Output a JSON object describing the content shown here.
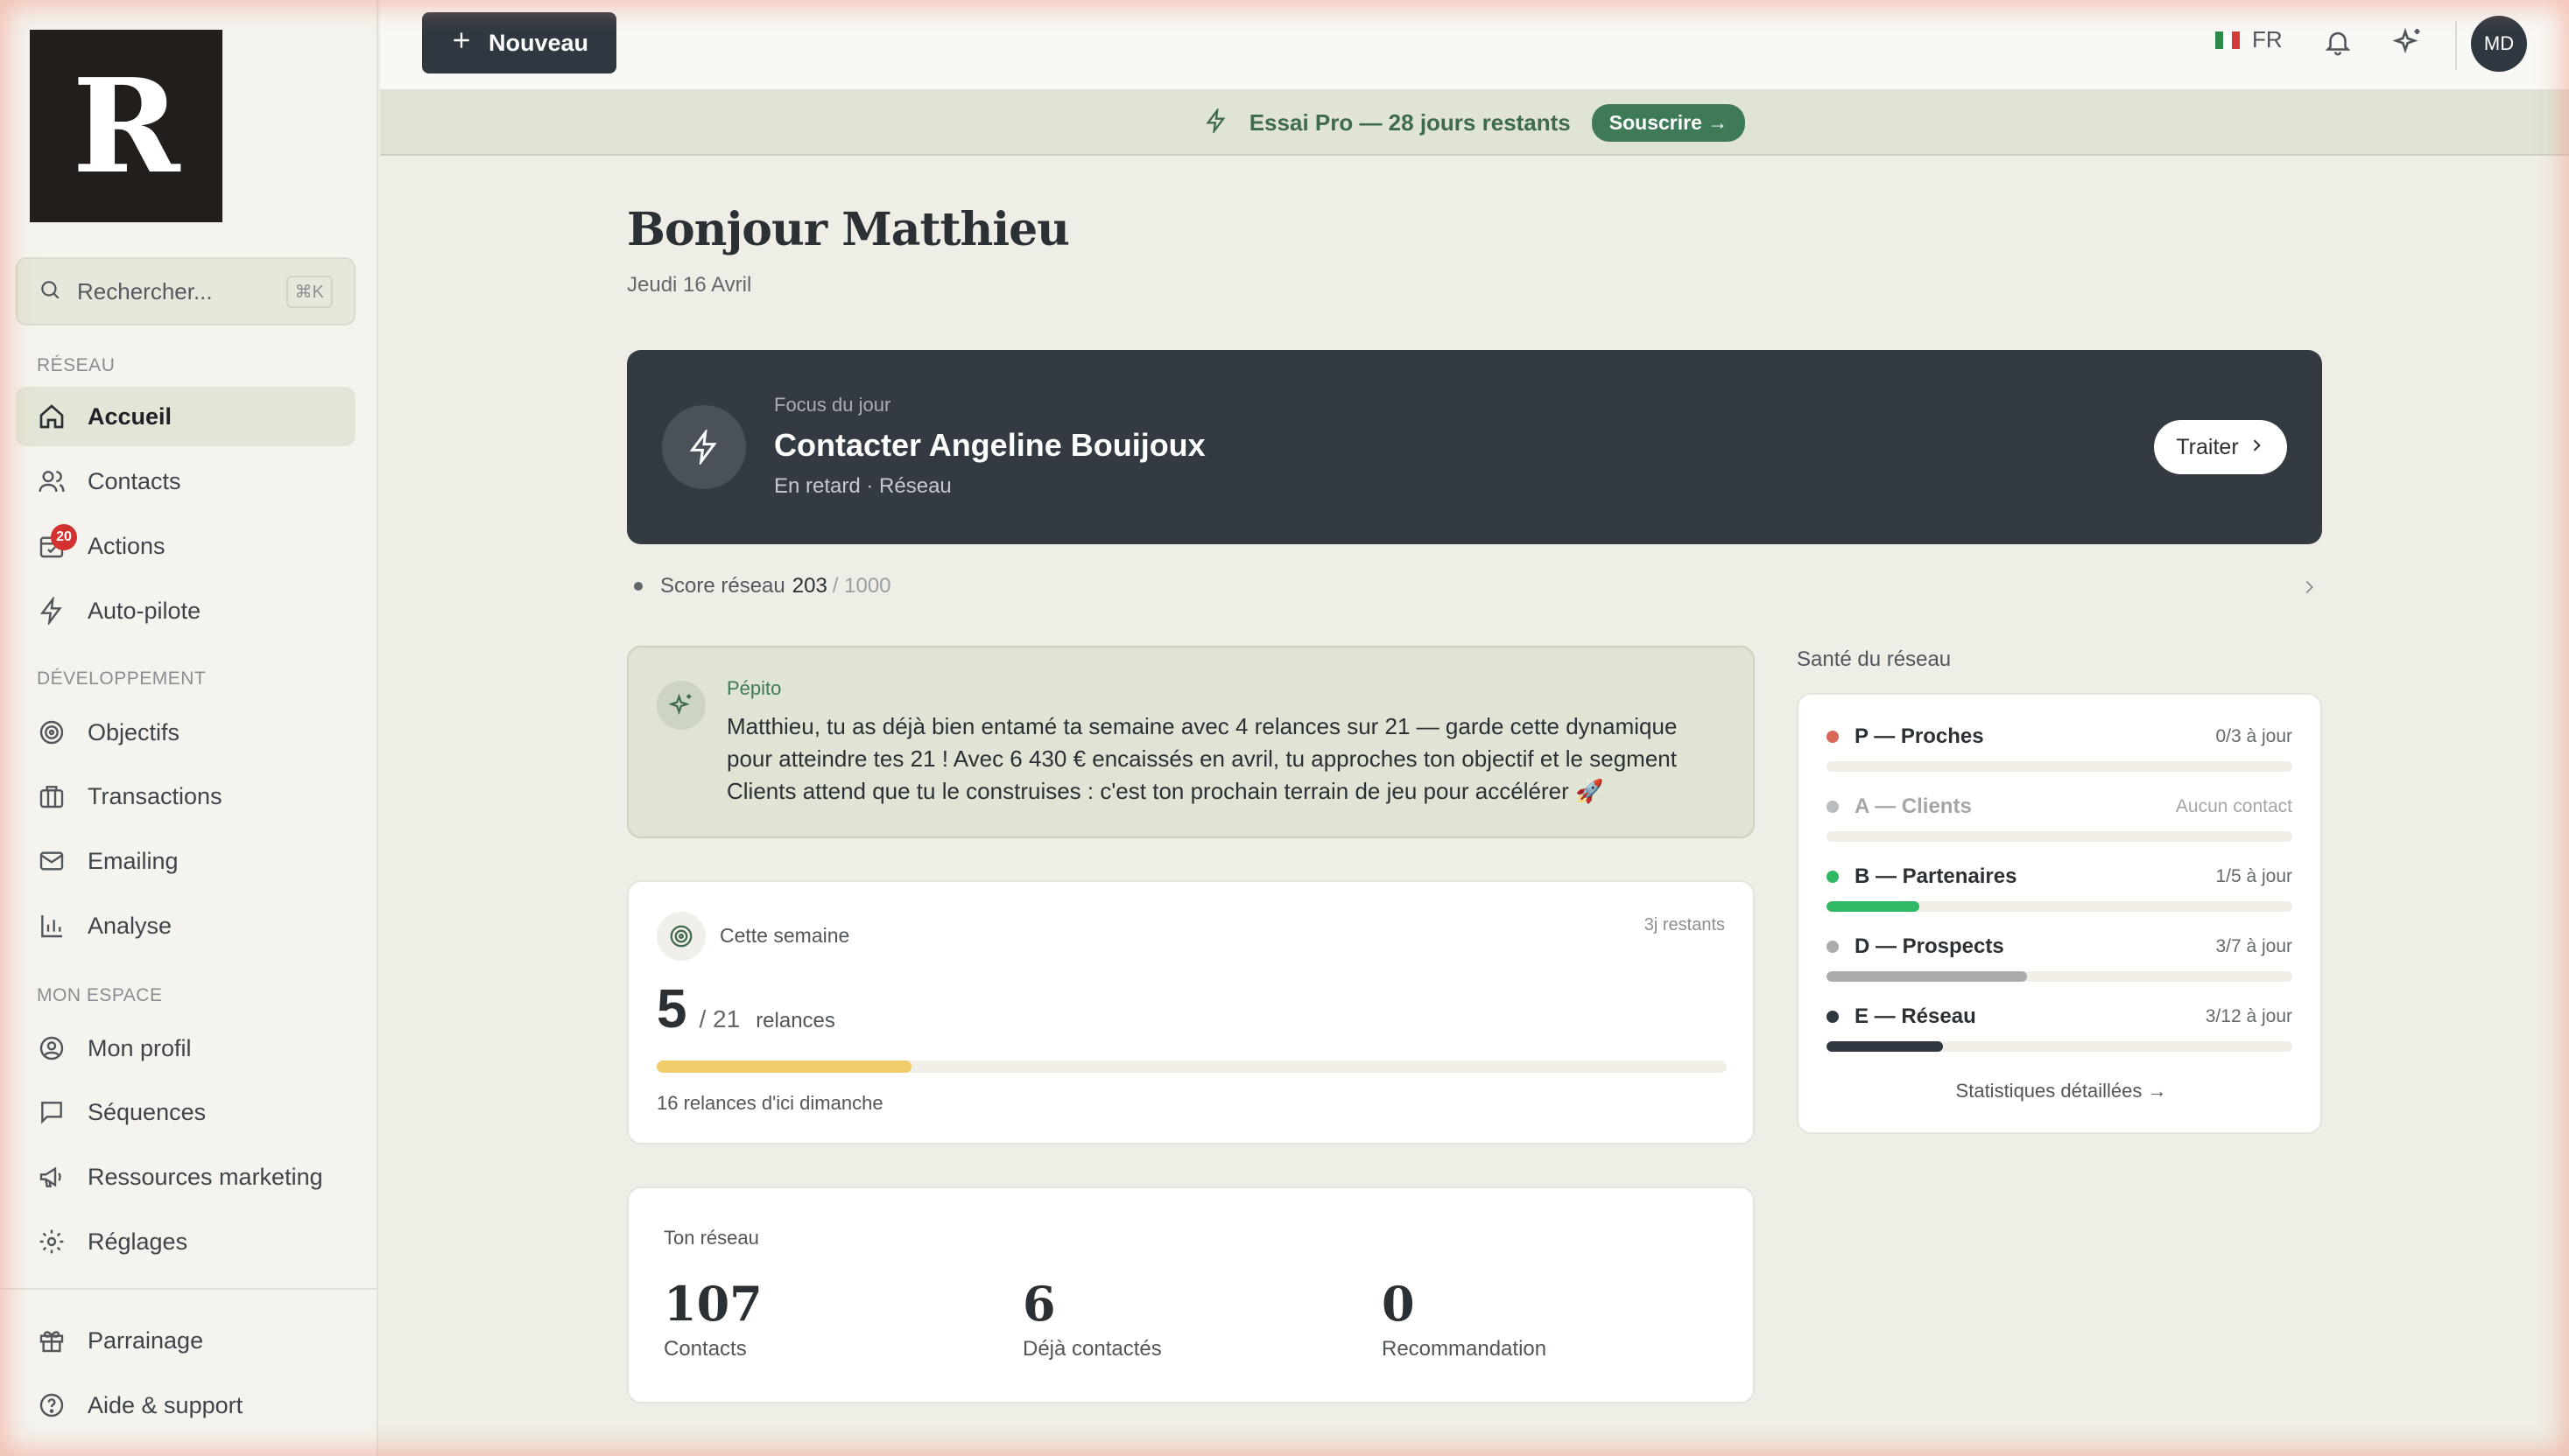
{
  "logo_letter": "R",
  "search": {
    "placeholder": "Rechercher...",
    "shortcut": "⌘K"
  },
  "sidebar": {
    "sections": [
      {
        "label": "RÉSEAU"
      },
      {
        "label": "DÉVELOPPEMENT"
      },
      {
        "label": "MON ESPACE"
      }
    ],
    "items": [
      {
        "label": "Accueil",
        "icon": "home-icon",
        "active": true
      },
      {
        "label": "Contacts",
        "icon": "users-icon"
      },
      {
        "label": "Actions",
        "icon": "calendar-check-icon",
        "badge": "20"
      },
      {
        "label": "Auto-pilote",
        "icon": "bolt-icon"
      },
      {
        "label": "Objectifs",
        "icon": "target-icon"
      },
      {
        "label": "Transactions",
        "icon": "briefcase-icon"
      },
      {
        "label": "Emailing",
        "icon": "mail-icon"
      },
      {
        "label": "Analyse",
        "icon": "bar-chart-icon"
      },
      {
        "label": "Mon profil",
        "icon": "user-circle-icon"
      },
      {
        "label": "Séquences",
        "icon": "message-square-icon"
      },
      {
        "label": "Ressources marketing",
        "icon": "megaphone-icon"
      },
      {
        "label": "Réglages",
        "icon": "gear-icon"
      },
      {
        "label": "Parrainage",
        "icon": "gift-icon"
      },
      {
        "label": "Aide & support",
        "icon": "help-circle-icon"
      }
    ]
  },
  "topbar": {
    "new_label": "Nouveau",
    "lang": "FR",
    "avatar_initials": "MD"
  },
  "trial": {
    "text": "Essai Pro — 28 jours restants",
    "cta": "Souscrire →"
  },
  "greeting": {
    "title": "Bonjour Matthieu",
    "date": "Jeudi 16 Avril"
  },
  "focus": {
    "label": "Focus du jour",
    "title": "Contacter Angeline Bouijoux",
    "meta": "En retard · Réseau",
    "button": "Traiter"
  },
  "score": {
    "label": "Score réseau",
    "value": "203",
    "total": "/ 1000"
  },
  "pepito": {
    "name": "Pépito",
    "message": "Matthieu, tu as déjà bien entamé ta semaine avec 4 relances sur 21 — garde cette dynamique pour atteindre tes 21 ! Avec 6 430 € encaissés en avril, tu approches ton objectif et le segment Clients attend que tu le construises : c'est ton prochain terrain de jeu pour accélérer 🚀"
  },
  "week": {
    "title": "Cette semaine",
    "remaining": "3j restants",
    "value": "5",
    "target": "/ 21",
    "unit": "relances",
    "progress": 0.238,
    "footer": "16 relances d'ici dimanche"
  },
  "network": {
    "title": "Ton réseau",
    "stats": [
      {
        "value": "107",
        "label": "Contacts"
      },
      {
        "value": "6",
        "label": "Déjà contactés"
      },
      {
        "value": "0",
        "label": "Recommandation"
      }
    ]
  },
  "health": {
    "title": "Santé du réseau",
    "rows": [
      {
        "name": "P — Proches",
        "value": "0/3 à jour",
        "progress": 0,
        "color": "#d9675a"
      },
      {
        "name": "A — Clients",
        "value": "Aucun contact",
        "progress": 0,
        "color": "#b9bcbe",
        "muted": true
      },
      {
        "name": "B — Partenaires",
        "value": "1/5 à jour",
        "progress": 0.2,
        "color": "#2fb866"
      },
      {
        "name": "D — Prospects",
        "value": "3/7 à jour",
        "progress": 0.43,
        "color": "#a9acaa"
      },
      {
        "name": "E — Réseau",
        "value": "3/12 à jour",
        "progress": 0.25,
        "color": "#2f3840"
      }
    ],
    "link": "Statistiques détaillées →"
  },
  "colors": {
    "accent_green": "#3f7a58",
    "dark": "#333a42",
    "progress_yellow": "#f0cc6a"
  }
}
